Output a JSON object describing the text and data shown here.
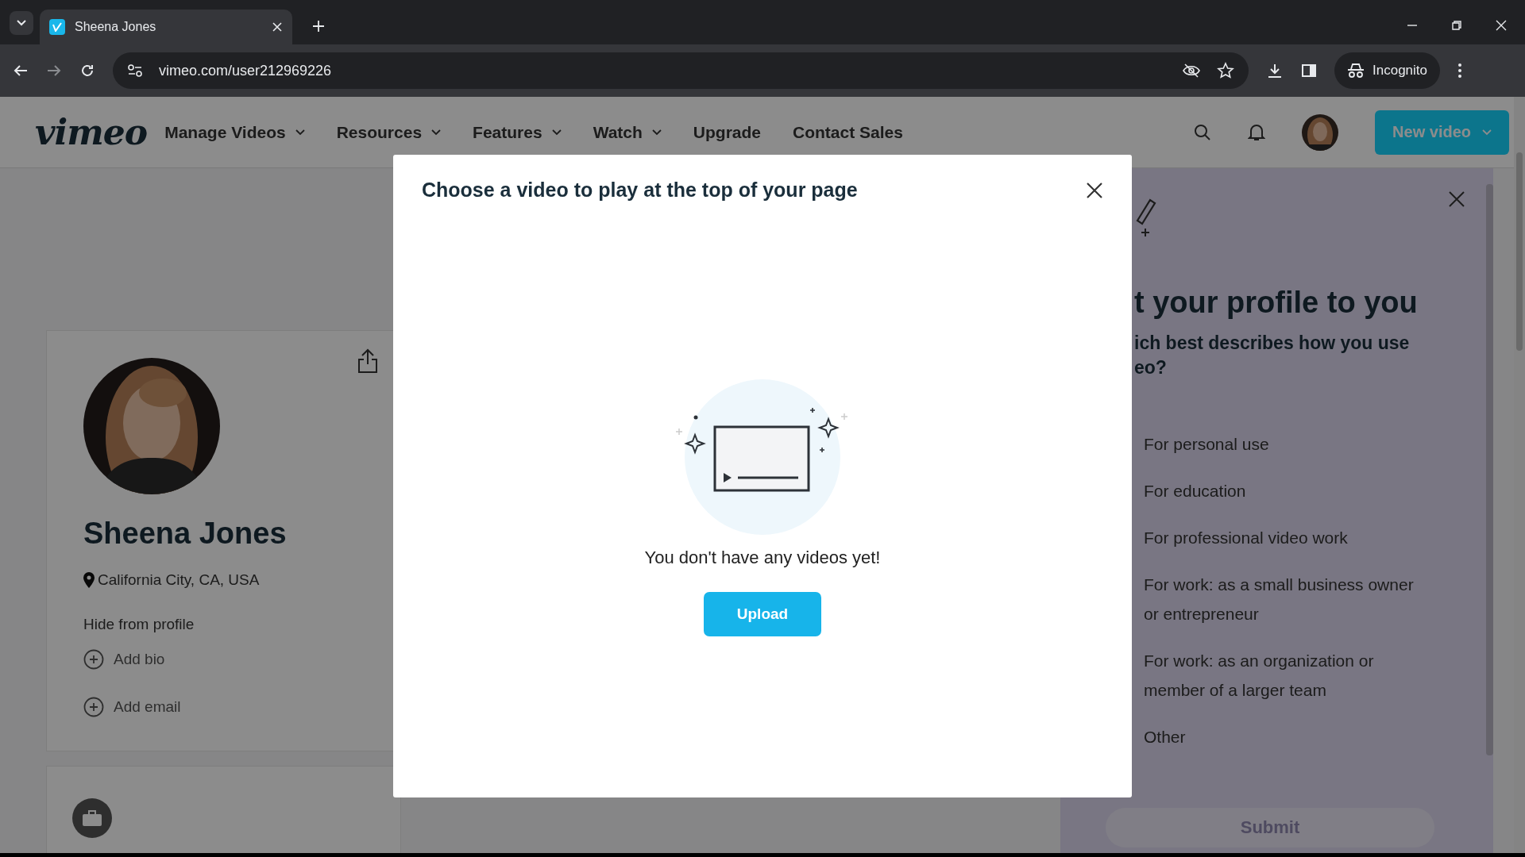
{
  "browser": {
    "tab_title": "Sheena Jones",
    "url": "vimeo.com/user212969226",
    "profile_label": "Incognito"
  },
  "nav": {
    "logo": "vimeo",
    "items": [
      {
        "label": "Manage Videos",
        "dropdown": true
      },
      {
        "label": "Resources",
        "dropdown": true
      },
      {
        "label": "Features",
        "dropdown": true
      },
      {
        "label": "Watch",
        "dropdown": true
      },
      {
        "label": "Upgrade",
        "dropdown": false
      },
      {
        "label": "Contact Sales",
        "dropdown": false
      }
    ],
    "new_video_button": "New video"
  },
  "profile": {
    "name": "Sheena Jones",
    "location": "California City, CA, USA",
    "hide_link": "Hide from profile",
    "actions": [
      "Add bio",
      "Add email"
    ]
  },
  "modal": {
    "title": "Choose a video to play at the top of your page",
    "empty_message": "You don't have any videos yet!",
    "upload_button": "Upload"
  },
  "survey_panel": {
    "title": "t your profile to you",
    "question": "ich best describes how you use\neo?",
    "options": [
      "For personal use",
      "For education",
      "For professional video work",
      "For work: as a small business owner or entrepreneur",
      "For work: as an organization or member of a larger team",
      "Other"
    ],
    "submit_button": "Submit"
  }
}
